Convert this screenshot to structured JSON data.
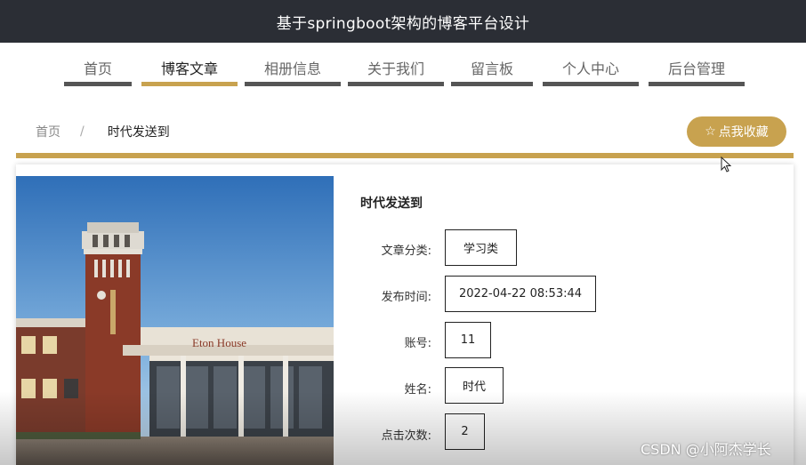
{
  "header": {
    "title": "基于springboot架构的博客平台设计"
  },
  "nav": {
    "items": [
      {
        "label": "首页",
        "active": false
      },
      {
        "label": "博客文章",
        "active": true
      },
      {
        "label": "相册信息",
        "active": false
      },
      {
        "label": "关于我们",
        "active": false
      },
      {
        "label": "留言板",
        "active": false
      },
      {
        "label": "个人中心",
        "active": false
      },
      {
        "label": "后台管理",
        "active": false
      }
    ]
  },
  "breadcrumb": {
    "home": "首页",
    "separator": "/",
    "current": "时代发送到"
  },
  "favorite_button": {
    "label": "点我收藏",
    "icon": "star-outline-icon"
  },
  "article": {
    "title": "时代发送到",
    "fields": [
      {
        "label": "文章分类:",
        "value": "学习类"
      },
      {
        "label": "发布时间:",
        "value": "2022-04-22 08:53:44"
      },
      {
        "label": "账号:",
        "value": "11"
      },
      {
        "label": "姓名:",
        "value": "时代"
      },
      {
        "label": "点击次数:",
        "value": "2"
      }
    ]
  },
  "photo": {
    "sign_text": "Eton House"
  },
  "watermark": "CSDN @小阿杰学长",
  "colors": {
    "accent": "#c8a24f",
    "header_bg": "#2b2e35",
    "nav_bar": "#555555"
  }
}
